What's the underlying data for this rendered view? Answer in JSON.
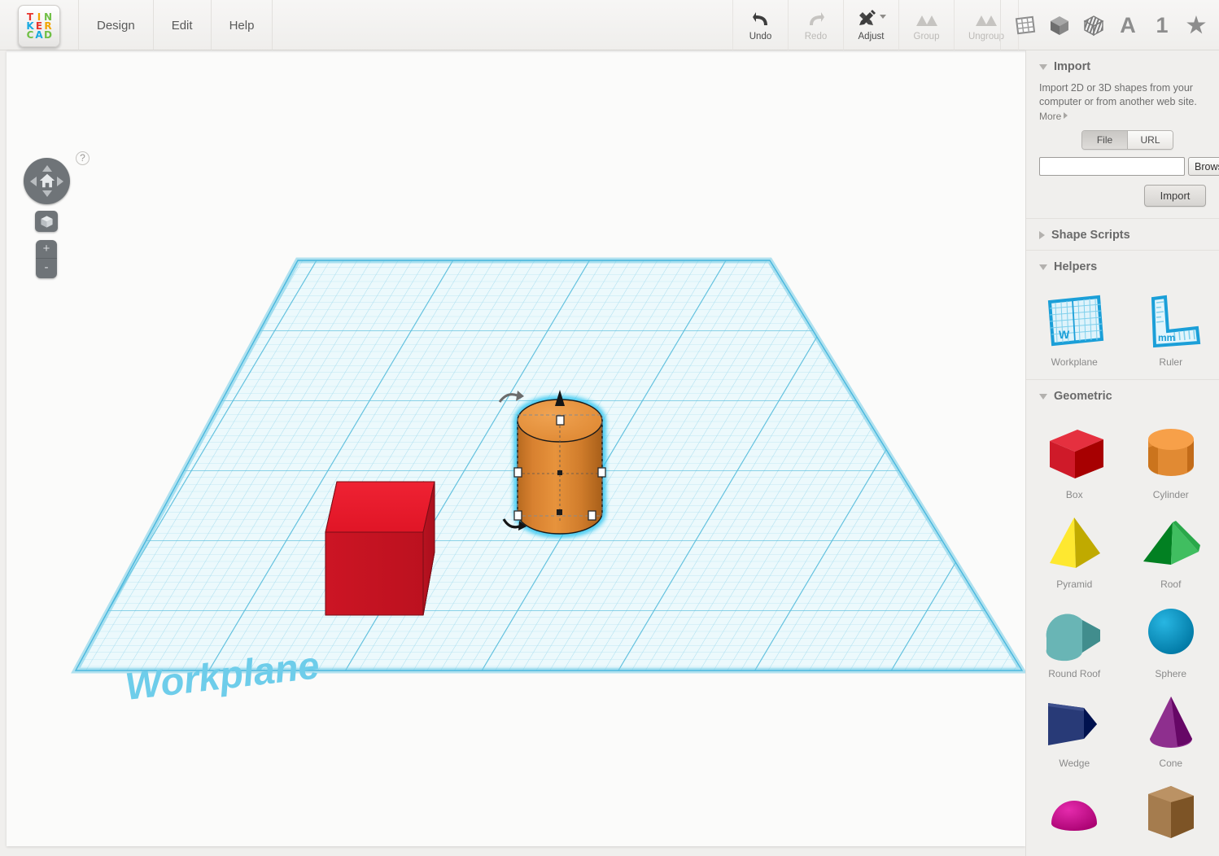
{
  "app": {
    "logo_letters": [
      {
        "ch": "T",
        "color": "#e8352e"
      },
      {
        "ch": "I",
        "color": "#f0a500"
      },
      {
        "ch": "N",
        "color": "#6fbf44"
      },
      {
        "ch": "K",
        "color": "#19a9e0"
      },
      {
        "ch": "E",
        "color": "#e8352e"
      },
      {
        "ch": "R",
        "color": "#f0a500"
      },
      {
        "ch": "C",
        "color": "#6fbf44"
      },
      {
        "ch": "A",
        "color": "#19a9e0"
      },
      {
        "ch": "D",
        "color": "#6fbf44"
      }
    ]
  },
  "menu": {
    "items": [
      {
        "label": "Design"
      },
      {
        "label": "Edit"
      },
      {
        "label": "Help"
      }
    ]
  },
  "toolbar": {
    "tools": [
      {
        "label": "Undo",
        "icon": "undo-icon",
        "disabled": false
      },
      {
        "label": "Redo",
        "icon": "redo-icon",
        "disabled": true
      },
      {
        "label": "Adjust",
        "icon": "adjust-icon",
        "disabled": false,
        "has_dropdown": true
      },
      {
        "label": "Group",
        "icon": "group-icon",
        "disabled": true
      },
      {
        "label": "Ungroup",
        "icon": "ungroup-icon",
        "disabled": true
      }
    ],
    "right_icons": [
      {
        "name": "workplane-grid-icon",
        "glyph": ""
      },
      {
        "name": "solid-cube-icon",
        "glyph": ""
      },
      {
        "name": "hatched-cube-icon",
        "glyph": ""
      },
      {
        "name": "text-letter-icon",
        "glyph": "A"
      },
      {
        "name": "number-one-icon",
        "glyph": "1"
      },
      {
        "name": "favorite-star-icon",
        "glyph": "★"
      }
    ]
  },
  "canvas": {
    "workplane_label": "Workplane",
    "help_label": "?",
    "zoom_in_label": "+",
    "zoom_out_label": "-",
    "objects": [
      {
        "name": "red-box",
        "shape": "box",
        "color": "#d91f2c",
        "selected": false
      },
      {
        "name": "orange-cylinder",
        "shape": "cylinder",
        "color": "#e08a30",
        "selected": true
      }
    ],
    "grid_color": "#53c0e0",
    "plane_fill": "#e9f7fb"
  },
  "panel": {
    "import": {
      "title": "Import",
      "expanded": true,
      "description": "Import 2D or 3D shapes from your computer or from another web site.",
      "more_label": "More",
      "tabs": [
        {
          "label": "File",
          "active": true
        },
        {
          "label": "URL",
          "active": false
        }
      ],
      "file_value": "",
      "browse_label": "Browse...",
      "import_label": "Import"
    },
    "shape_scripts": {
      "title": "Shape Scripts",
      "expanded": false
    },
    "helpers": {
      "title": "Helpers",
      "expanded": true,
      "items": [
        {
          "label": "Workplane",
          "icon": "workplane-helper-icon",
          "badge": "W"
        },
        {
          "label": "Ruler",
          "icon": "ruler-helper-icon",
          "badge": "mm"
        }
      ]
    },
    "geometric": {
      "title": "Geometric",
      "expanded": true,
      "items": [
        {
          "label": "Box",
          "shape": "box",
          "color": "#cf1a29"
        },
        {
          "label": "Cylinder",
          "shape": "cylinder",
          "color": "#e18a33"
        },
        {
          "label": "Pyramid",
          "shape": "pyramid",
          "color": "#e8d21a"
        },
        {
          "label": "Roof",
          "shape": "roof",
          "color": "#2aa84a"
        },
        {
          "label": "Round Roof",
          "shape": "round-roof",
          "color": "#69b5b5"
        },
        {
          "label": "Sphere",
          "shape": "sphere",
          "color": "#12a0cc"
        },
        {
          "label": "Wedge",
          "shape": "wedge",
          "color": "#283a77"
        },
        {
          "label": "Cone",
          "shape": "cone",
          "color": "#8e2f8e"
        },
        {
          "label": "",
          "shape": "half-sphere",
          "color": "#cf1597"
        },
        {
          "label": "",
          "shape": "hexagon-prism",
          "color": "#a57c4e"
        }
      ]
    }
  }
}
